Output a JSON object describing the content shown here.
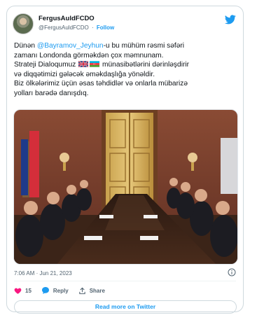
{
  "author": {
    "display_name": "FergusAuldFCDO",
    "handle": "@FergusAuldFCDO",
    "separator": "·",
    "follow_label": "Follow"
  },
  "tweet": {
    "line1_prefix": "Dünən ",
    "mention": "@Bayramov_Jeyhun",
    "line1_suffix": "-u bu mühüm rəsmi səfəri",
    "line2": "zamanı Londonda görməkdən çox məmnunam.",
    "line3_prefix": "Strateji Dialoqumuz ",
    "line3_suffix": " münasibətlərini dərinləşdirir",
    "line4": "və diqqətimizi gələcək əməkdaşlığa yönəldir.",
    "line5": "Biz ölkələrimiz üçün əsas təhdidlər və onlarla mübarizə",
    "line6": "yolları barədə danışdıq."
  },
  "timestamp": "7:06 AM · Jun 21, 2023",
  "actions": {
    "like_count": "15",
    "reply_label": "Reply",
    "share_label": "Share"
  },
  "read_more_label": "Read more on Twitter",
  "icons": {
    "bird": "twitter-bird-icon",
    "info": "info-icon",
    "heart": "heart-icon",
    "reply": "reply-bubble-icon",
    "share": "share-icon",
    "flag_uk": "uk-flag-icon",
    "flag_az": "azerbaijan-flag-icon"
  },
  "colors": {
    "accent": "#1d9bf0",
    "like": "#f91880",
    "text": "#0f1419",
    "muted": "#536471",
    "border": "#cfd9de"
  }
}
